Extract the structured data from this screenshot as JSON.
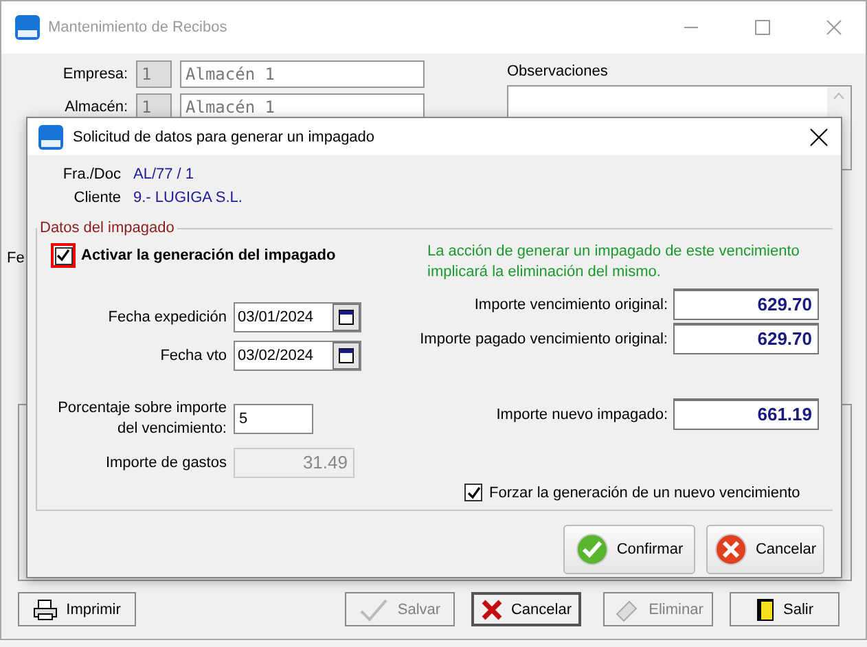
{
  "main_window": {
    "title": "Mantenimiento de Recibos",
    "fields": [
      {
        "label": "Empresa:",
        "code": "1",
        "name": "Almacén 1"
      },
      {
        "label": "Almacén:",
        "code": "1",
        "name": "Almacén 1"
      }
    ],
    "observaciones_label": "Observaciones",
    "partial_label": "Fe",
    "buttons": [
      {
        "label": "Imprimir",
        "kind": "print",
        "disabled": false
      },
      {
        "label": "Salvar",
        "kind": "save",
        "disabled": true
      },
      {
        "label": "Cancelar",
        "kind": "cancel",
        "disabled": false
      },
      {
        "label": "Eliminar",
        "kind": "delete",
        "disabled": true
      },
      {
        "label": "Salir",
        "kind": "exit",
        "disabled": false
      }
    ]
  },
  "dialog": {
    "title": "Solicitud de datos para generar un impagado",
    "info": [
      {
        "label": "Fra./Doc",
        "value": "AL/77 / 1"
      },
      {
        "label": "Cliente",
        "value": "9.- LUGIGA S.L."
      }
    ],
    "group_title": "Datos del impagado",
    "activate": {
      "label": "Activar la generación del impagado",
      "checked": true
    },
    "notice": "La acción de generar un impagado de este vencimiento implicará la eliminación del mismo.",
    "left_fields": [
      {
        "label": "Fecha expedición",
        "value": "03/01/2024",
        "kind": "date"
      },
      {
        "label": "Fecha vto",
        "value": "03/02/2024",
        "kind": "date"
      },
      {
        "label": "Porcentaje sobre importe del vencimiento:",
        "value": "5",
        "kind": "input"
      },
      {
        "label": "Importe de gastos",
        "value": "31.49",
        "kind": "readonly"
      }
    ],
    "right_fields": [
      {
        "label": "Importe vencimiento original:",
        "value": "629.70"
      },
      {
        "label": "Importe pagado vencimiento original:",
        "value": "629.70"
      },
      {
        "label": "Importe nuevo impagado:",
        "value": "661.19"
      }
    ],
    "force": {
      "label": "Forzar la generación de un nuevo vencimiento",
      "checked": true
    },
    "buttons": [
      {
        "label": "Confirmar",
        "kind": "confirm"
      },
      {
        "label": "Cancelar",
        "kind": "cancel"
      }
    ]
  }
}
